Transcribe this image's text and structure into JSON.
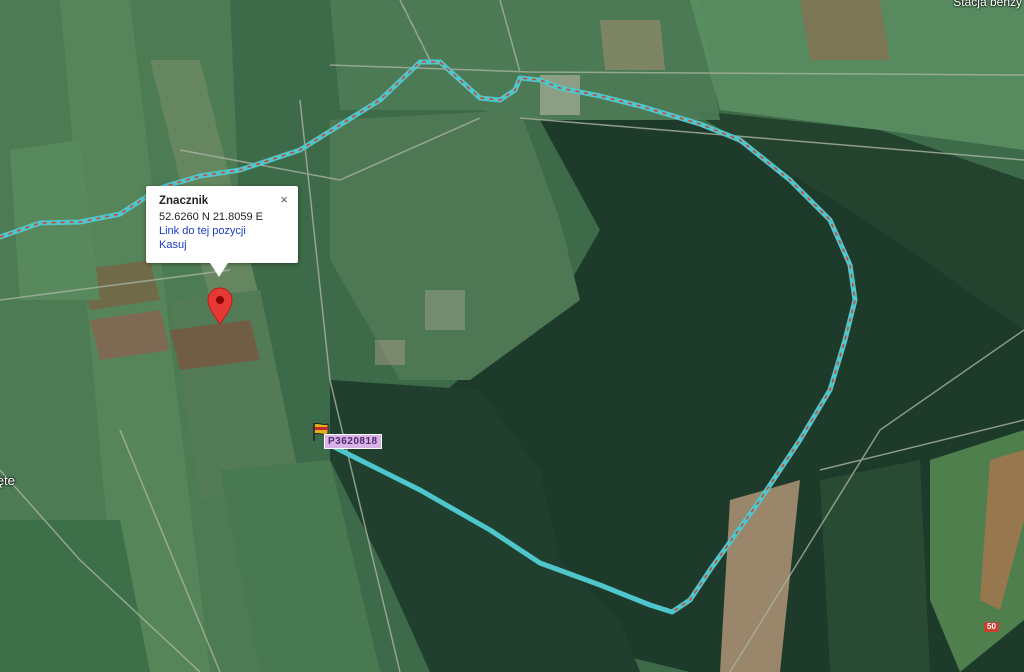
{
  "map": {
    "top_right_label": "Stacja benzy",
    "left_label": "Zięte",
    "road_number": "50"
  },
  "info_window": {
    "title": "Znacznik",
    "coordinates": "52.6260 N 21.8059 E",
    "link_label": "Link do tej pozycji",
    "delete_label": "Kasuj",
    "close_symbol": "×"
  },
  "waypoint": {
    "label": "P3620818"
  },
  "route": {
    "line_color": "#4fc6cc",
    "dash_color": "#d2452f"
  },
  "marker": {
    "icon": "map-pin-icon",
    "color": "#e53935"
  }
}
